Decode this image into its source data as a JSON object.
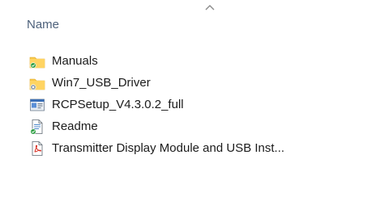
{
  "header": {
    "sort_icon": "chevron-up-icon",
    "name_label": "Name"
  },
  "files": [
    {
      "name": "Manuals",
      "icon": "folder-sync-ok-icon"
    },
    {
      "name": "Win7_USB_Driver",
      "icon": "folder-sync-pending-icon"
    },
    {
      "name": "RCPSetup_V4.3.0.2_full",
      "icon": "application-installer-icon"
    },
    {
      "name": "Readme",
      "icon": "text-document-sync-ok-icon"
    },
    {
      "name": "Transmitter Display Module and USB Inst...",
      "icon": "pdf-document-icon"
    }
  ],
  "colors": {
    "header_text": "#4c607a",
    "item_text": "#1b1b1b",
    "folder": "#f8c84a",
    "sync_ok": "#2ea043",
    "sync_pending": "#9aa4ae",
    "pdf_red": "#d93025"
  }
}
